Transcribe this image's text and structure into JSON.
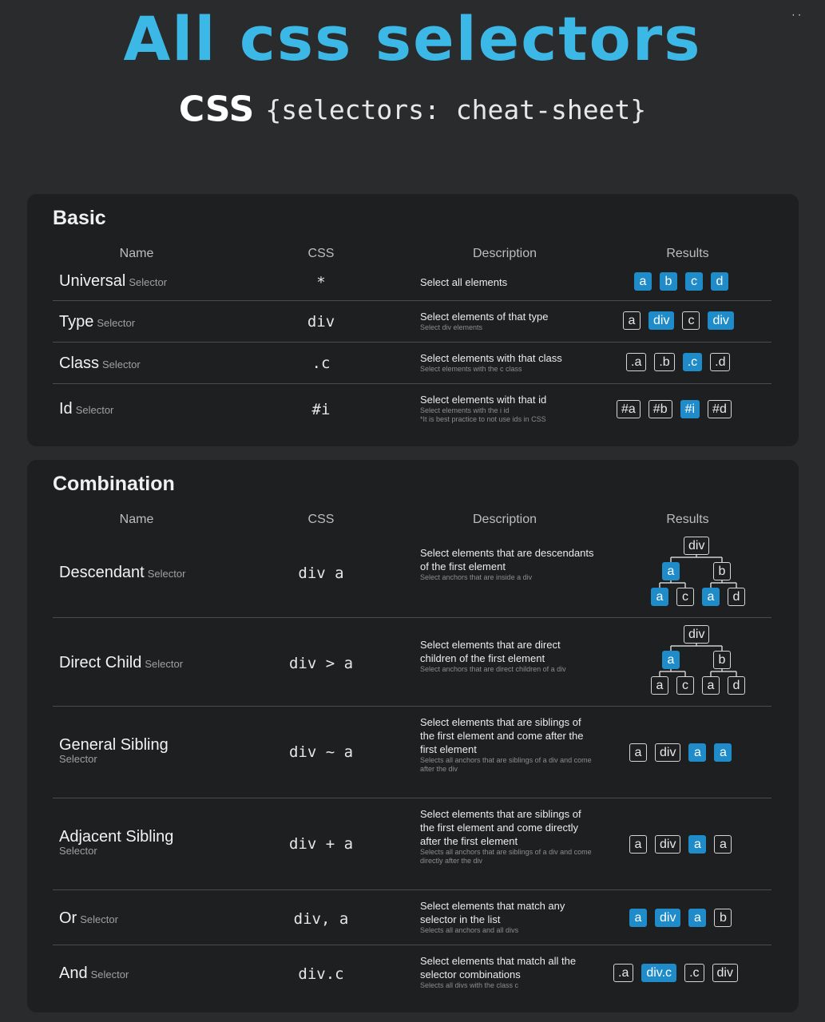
{
  "header": {
    "title": "All css selectors",
    "subtitle_css": "CSS",
    "subtitle_rest": "{selectors: cheat-sheet}",
    "corner_mark": "· ·"
  },
  "basic": {
    "title": "Basic",
    "columns": [
      "Name",
      "CSS",
      "Description",
      "Results"
    ],
    "rows": [
      {
        "name": "Universal",
        "suffix": "Selector",
        "css": "*",
        "desc": "Select all elements",
        "sub": "",
        "results": [
          {
            "t": "a",
            "hl": true
          },
          {
            "t": "b",
            "hl": true
          },
          {
            "t": "c",
            "hl": true
          },
          {
            "t": "d",
            "hl": true
          }
        ]
      },
      {
        "name": "Type",
        "suffix": "Selector",
        "css": "div",
        "desc": "Select elements of that type",
        "sub": "Select div elements",
        "results": [
          {
            "t": "a",
            "hl": false
          },
          {
            "t": "div",
            "hl": true
          },
          {
            "t": "c",
            "hl": false
          },
          {
            "t": "div",
            "hl": true
          }
        ]
      },
      {
        "name": "Class",
        "suffix": "Selector",
        "css": ".c",
        "desc": "Select elements with that class",
        "sub": "Select elements with the c class",
        "results": [
          {
            "t": ".a",
            "hl": false
          },
          {
            "t": ".b",
            "hl": false
          },
          {
            "t": ".c",
            "hl": true
          },
          {
            "t": ".d",
            "hl": false
          }
        ]
      },
      {
        "name": "Id",
        "suffix": "Selector",
        "css": "#i",
        "desc": "Select elements with that id",
        "sub": "Select elements with the i id",
        "sub2": "*It is best practice to not use ids in CSS",
        "results": [
          {
            "t": "#a",
            "hl": false
          },
          {
            "t": "#b",
            "hl": false
          },
          {
            "t": "#i",
            "hl": true
          },
          {
            "t": "#d",
            "hl": false
          }
        ]
      }
    ]
  },
  "combination": {
    "title": "Combination",
    "columns": [
      "Name",
      "CSS",
      "Description",
      "Results"
    ],
    "rows": [
      {
        "name": "Descendant",
        "suffix": "Selector",
        "css": "div a",
        "desc": "Select elements that are descendants of the first element",
        "sub": "Select anchors that are inside a div",
        "tree": {
          "root": "div",
          "mid": [
            {
              "t": "a",
              "hl": true
            },
            {
              "t": "b",
              "hl": false
            }
          ],
          "leaves": [
            {
              "t": "a",
              "hl": true
            },
            {
              "t": "c",
              "hl": false
            },
            {
              "t": "a",
              "hl": true
            },
            {
              "t": "d",
              "hl": false
            }
          ]
        }
      },
      {
        "name": "Direct Child",
        "suffix": "Selector",
        "css": "div > a",
        "desc": "Select elements that are direct children of the first element",
        "sub": "Select anchors that are direct children of a div",
        "tree": {
          "root": "div",
          "mid": [
            {
              "t": "a",
              "hl": true
            },
            {
              "t": "b",
              "hl": false
            }
          ],
          "leaves": [
            {
              "t": "a",
              "hl": false
            },
            {
              "t": "c",
              "hl": false
            },
            {
              "t": "a",
              "hl": false
            },
            {
              "t": "d",
              "hl": false
            }
          ]
        }
      },
      {
        "name": "General Sibling",
        "suffix": "Selector",
        "css": "div ~ a",
        "desc": "Select elements that are siblings of the first element and come after the first element",
        "sub": "Selects all anchors that are siblings of a div and come after the div",
        "results": [
          {
            "t": "a",
            "hl": false
          },
          {
            "t": "div",
            "hl": false
          },
          {
            "t": "a",
            "hl": true
          },
          {
            "t": "a",
            "hl": true
          }
        ]
      },
      {
        "name": "Adjacent Sibling",
        "suffix": "Selector",
        "css": "div + a",
        "desc": "Select elements that are siblings of the first element and come directly after the first element",
        "sub": "Selects all anchors that are siblings of a div and come directly after the div",
        "results": [
          {
            "t": "a",
            "hl": false
          },
          {
            "t": "div",
            "hl": false
          },
          {
            "t": "a",
            "hl": true
          },
          {
            "t": "a",
            "hl": false
          }
        ]
      },
      {
        "name": "Or",
        "suffix": "Selector",
        "css": "div, a",
        "desc": "Select elements that match any selector in the list",
        "sub": "Selects all anchors and all divs",
        "results": [
          {
            "t": "a",
            "hl": true
          },
          {
            "t": "div",
            "hl": true
          },
          {
            "t": "a",
            "hl": true
          },
          {
            "t": "b",
            "hl": false
          }
        ]
      },
      {
        "name": "And",
        "suffix": "Selector",
        "css": "div.c",
        "desc": "Select elements that match all the selector combinations",
        "sub": "Selects all divs with the class c",
        "results": [
          {
            "t": ".a",
            "hl": false
          },
          {
            "t": "div.c",
            "hl": true
          },
          {
            "t": ".c",
            "hl": false
          },
          {
            "t": "div",
            "hl": false
          }
        ]
      }
    ]
  }
}
